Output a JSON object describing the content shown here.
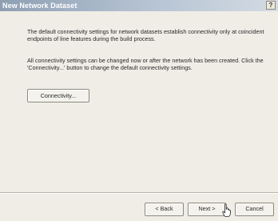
{
  "dialog": {
    "title": "New Network Dataset",
    "help_glyph": "?"
  },
  "content": {
    "paragraph1": "The default connectivity settings for network datasets establish connectivity only at coincident endpoints of line features during the build process.",
    "paragraph2": "All connectivity settings can be changed now or after the network has been created.  Click the 'Connectivity...' button to change the default connectivity settings.",
    "connectivity_button": "Connectivity..."
  },
  "footer": {
    "back_label": "< Back",
    "next_label": "Next >",
    "cancel_label": "Cancel"
  },
  "cursor_icon": "hand-pointer-icon"
}
